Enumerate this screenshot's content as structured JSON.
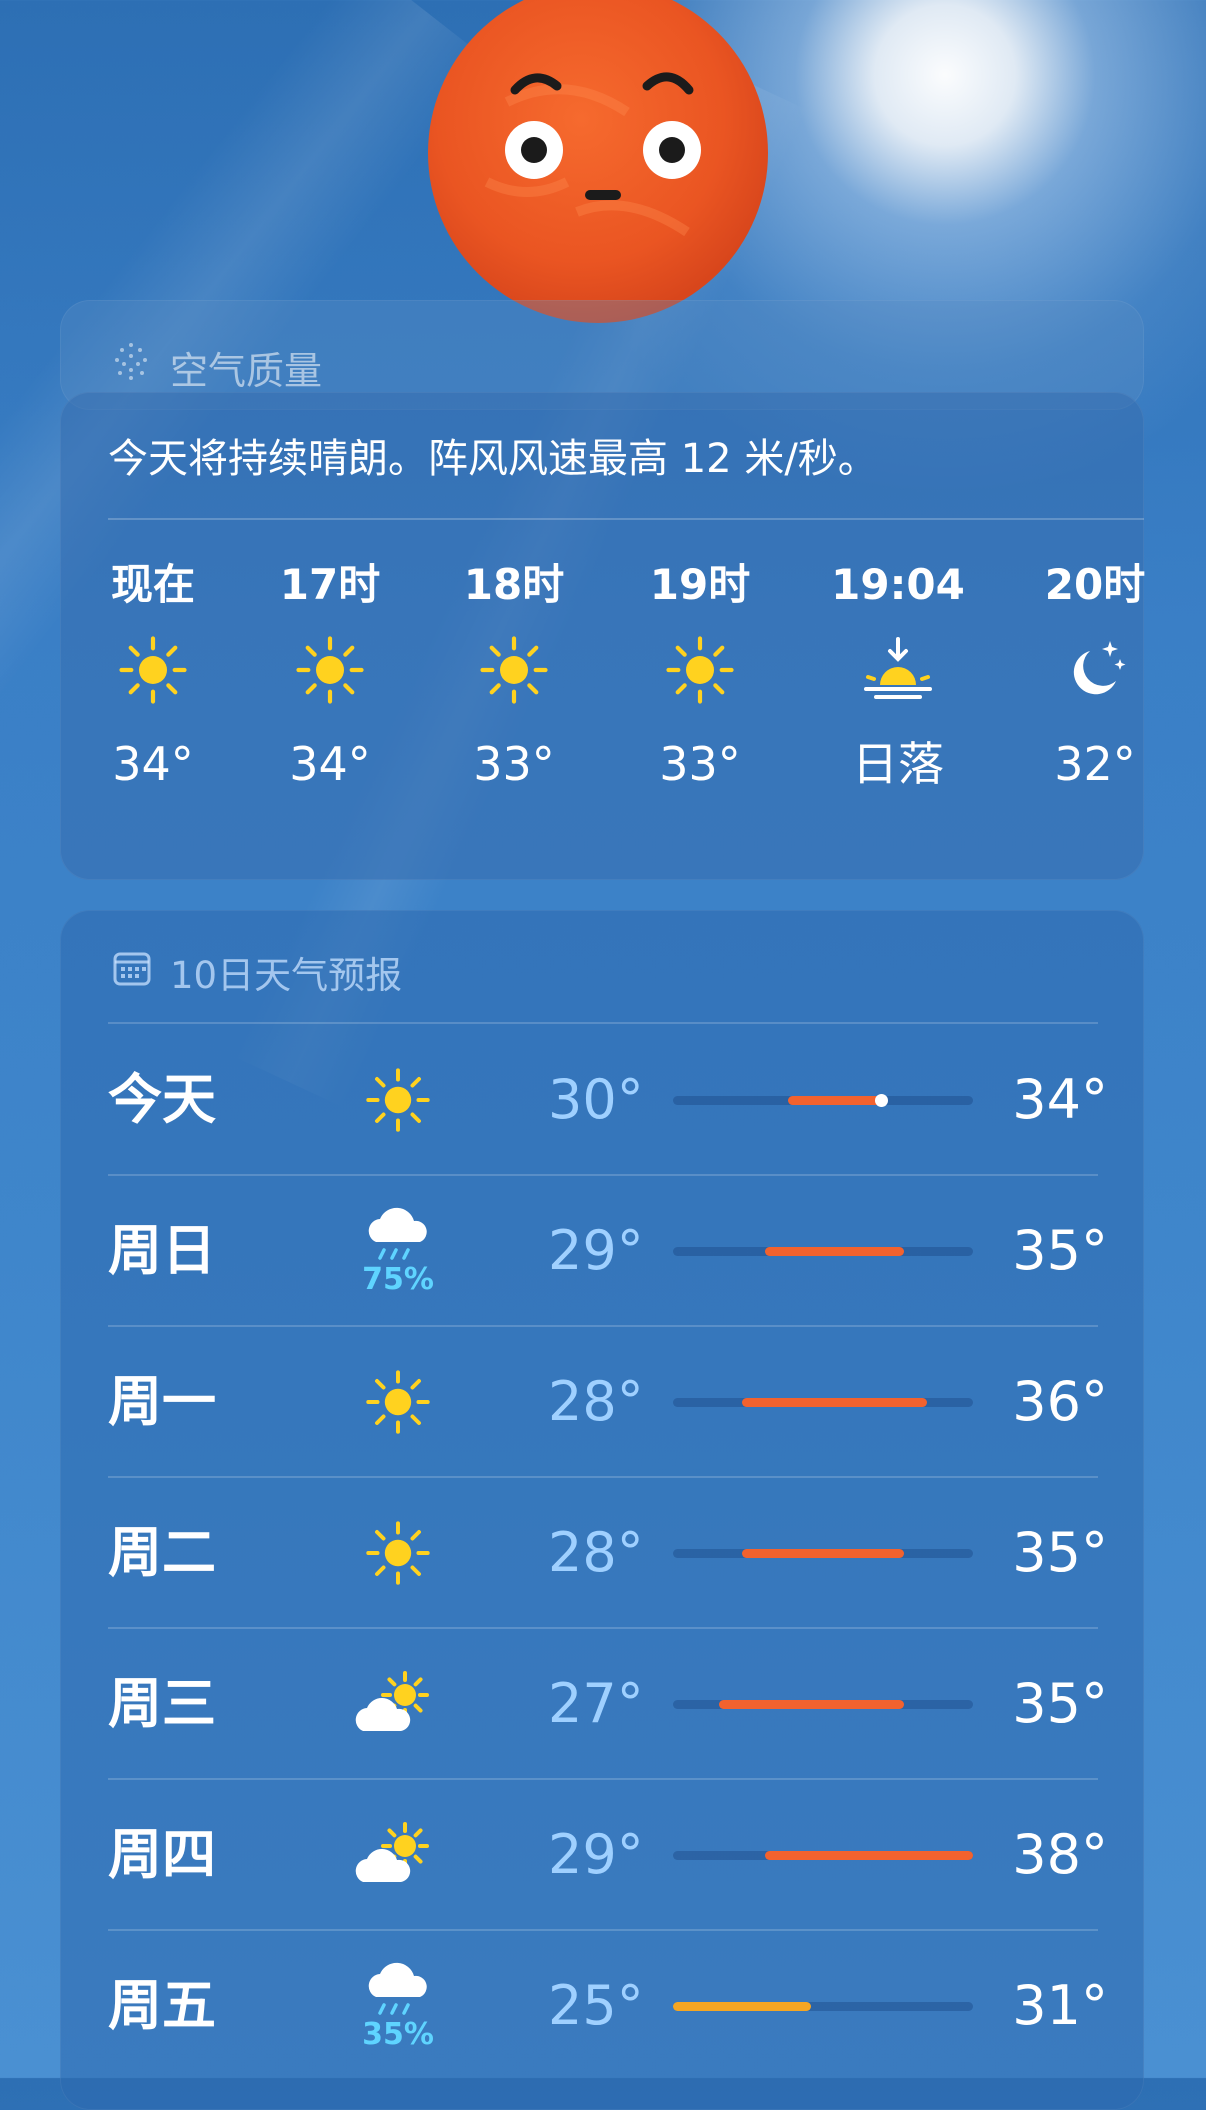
{
  "air_quality": {
    "label": "空气质量",
    "icon": "air-quality-icon"
  },
  "hourly": {
    "summary": "今天将持续晴朗。阵风风速最高 12 米/秒。",
    "items": [
      {
        "time": "现在",
        "icon": "sun-icon",
        "temp": "34°"
      },
      {
        "time": "17时",
        "icon": "sun-icon",
        "temp": "34°"
      },
      {
        "time": "18时",
        "icon": "sun-icon",
        "temp": "33°"
      },
      {
        "time": "19时",
        "icon": "sun-icon",
        "temp": "33°"
      },
      {
        "time": "19:04",
        "icon": "sunset-icon",
        "temp": "日落"
      },
      {
        "time": "20时",
        "icon": "moon-stars-icon",
        "temp": "32°"
      }
    ]
  },
  "forecast": {
    "title": "10日天气预报",
    "range_min": 25,
    "range_max": 38,
    "days": [
      {
        "day": "今天",
        "icon": "sun-icon",
        "precip": "",
        "low": "30°",
        "high": "34°",
        "low_value": 30,
        "high_value": 34,
        "current": 34
      },
      {
        "day": "周日",
        "icon": "rain-cloud-icon",
        "precip": "75%",
        "low": "29°",
        "high": "35°",
        "low_value": 29,
        "high_value": 35
      },
      {
        "day": "周一",
        "icon": "sun-icon",
        "precip": "",
        "low": "28°",
        "high": "36°",
        "low_value": 28,
        "high_value": 36
      },
      {
        "day": "周二",
        "icon": "sun-icon",
        "precip": "",
        "low": "28°",
        "high": "35°",
        "low_value": 28,
        "high_value": 35
      },
      {
        "day": "周三",
        "icon": "partly-cloudy-icon",
        "precip": "",
        "low": "27°",
        "high": "35°",
        "low_value": 27,
        "high_value": 35
      },
      {
        "day": "周四",
        "icon": "partly-cloudy-icon",
        "precip": "",
        "low": "29°",
        "high": "38°",
        "low_value": 29,
        "high_value": 38
      },
      {
        "day": "周五",
        "icon": "rain-cloud-icon",
        "precip": "35%",
        "low": "25°",
        "high": "31°",
        "low_value": 25,
        "high_value": 31
      }
    ]
  },
  "colors": {
    "sun": "#ffd21f",
    "bar_hot": "#f2622e",
    "bar_warm": "#f5a623",
    "low_temp": "#9fd0ff",
    "precip": "#5fd4ff"
  }
}
